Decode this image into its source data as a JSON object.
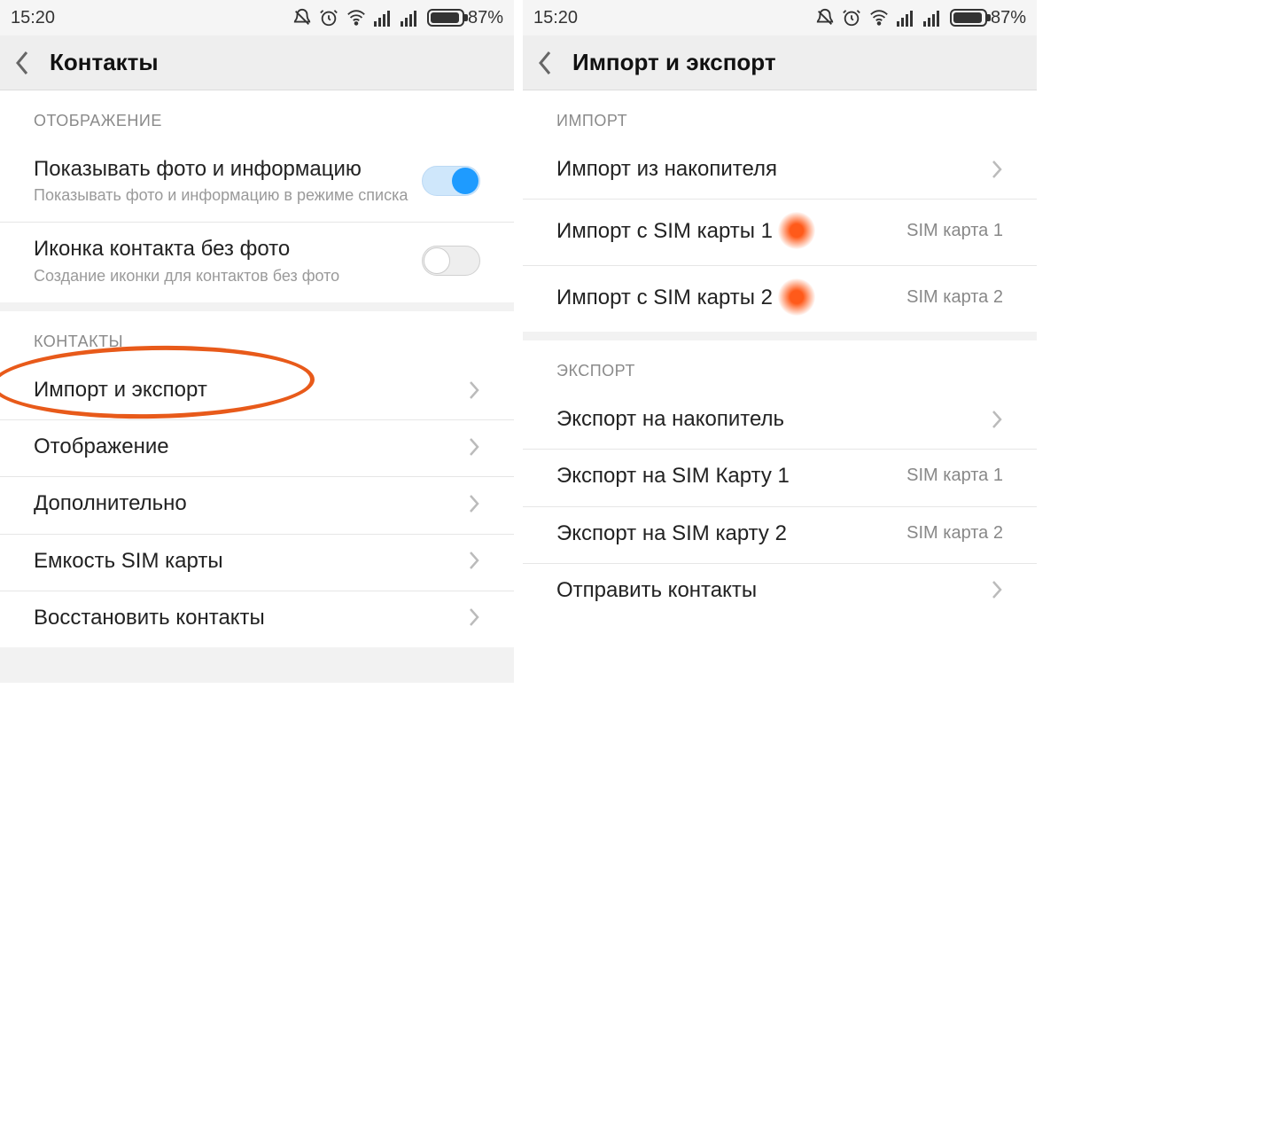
{
  "status": {
    "time": "15:20",
    "battery": "87%"
  },
  "left": {
    "title": "Контакты",
    "section_display": "ОТОБРАЖЕНИЕ",
    "row_photo_title": "Показывать фото и информацию",
    "row_photo_sub": "Показывать фото и информацию в режиме списка",
    "row_icon_title": "Иконка контакта без фото",
    "row_icon_sub": "Создание иконки для контактов без фото",
    "section_contacts": "КОНТАКТЫ",
    "row_import": "Импорт и экспорт",
    "row_display": "Отображение",
    "row_more": "Дополнительно",
    "row_sim_cap": "Емкость SIM карты",
    "row_restore": "Восстановить контакты"
  },
  "right": {
    "title": "Импорт и экспорт",
    "section_import": "ИМПОРТ",
    "row_imp_storage": "Импорт из накопителя",
    "row_imp_sim1": "Импорт с SIM карты 1",
    "row_imp_sim1_val": "SIM карта 1",
    "row_imp_sim2": "Импорт с SIM карты 2",
    "row_imp_sim2_val": "SIM карта 2",
    "section_export": "ЭКСПОРТ",
    "row_exp_storage": "Экспорт на накопитель",
    "row_exp_sim1": "Экспорт на SIM Карту 1",
    "row_exp_sim1_val": "SIM карта 1",
    "row_exp_sim2": "Экспорт на SIM карту 2",
    "row_exp_sim2_val": "SIM карта 2",
    "row_send": "Отправить контакты"
  }
}
